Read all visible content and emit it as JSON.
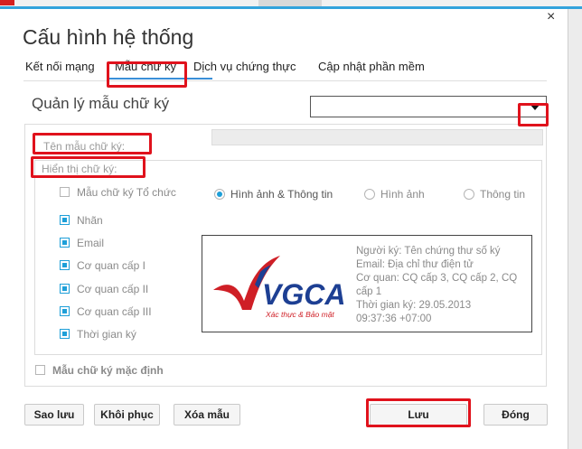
{
  "dialog": {
    "title": "Cấu hình hệ thống",
    "close_glyph": "×"
  },
  "tabs": [
    {
      "label": "Kết nối mạng"
    },
    {
      "label": "Mẫu chữ ký"
    },
    {
      "label": "Dịch vụ chứng thực"
    },
    {
      "label": "Cập nhật phần mềm"
    }
  ],
  "active_tab": "Mẫu chữ ký",
  "signature_template": {
    "manage_label": "Quản lý mẫu chữ ký",
    "select_value": "",
    "name_label": "Tên mẫu chữ ký:",
    "name_value": "",
    "display_label": "Hiển thị chữ ký:",
    "org_checkbox": {
      "label": "Mẫu chữ ký Tổ chức",
      "checked": false
    },
    "display_modes": [
      {
        "label": "Hình ảnh & Thông tin",
        "selected": true
      },
      {
        "label": "Hình ảnh",
        "selected": false
      },
      {
        "label": "Thông tin",
        "selected": false
      }
    ],
    "fields": [
      {
        "label": "Nhãn",
        "checked": true
      },
      {
        "label": "Email",
        "checked": true
      },
      {
        "label": "Cơ quan cấp I",
        "checked": true
      },
      {
        "label": "Cơ quan cấp II",
        "checked": true
      },
      {
        "label": "Cơ quan cấp III",
        "checked": true
      },
      {
        "label": "Thời gian ký",
        "checked": true
      }
    ],
    "preview": {
      "logo_text": "VGCA",
      "logo_tagline": "Xác thực & Bảo mật",
      "lines": [
        "Người ký: Tên chứng thư số ký",
        "Email: Địa chỉ thư điện tử",
        "Cơ quan: CQ cấp 3, CQ cấp 2, CQ",
        "cấp 1",
        "Thời gian ký: 29.05.2013",
        "09:37:36 +07:00"
      ]
    },
    "default_checkbox": {
      "label": "Mẫu chữ ký mặc định",
      "checked": false
    }
  },
  "buttons": {
    "backup": "Sao lưu",
    "restore": "Khôi phục",
    "delete": "Xóa mẫu",
    "save": "Lưu",
    "close": "Đóng"
  },
  "colors": {
    "accent": "#1e9fd8",
    "highlight": "#e0121c",
    "logo_red": "#cf1f26",
    "logo_blue": "#1d3f93"
  }
}
